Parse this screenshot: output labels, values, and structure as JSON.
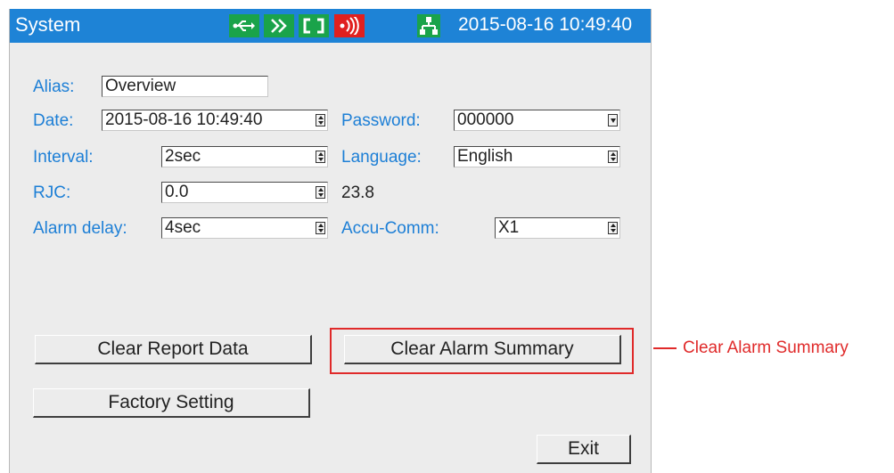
{
  "titlebar": {
    "title": "System",
    "datetime": "2015-08-16 10:49:40",
    "status_icons": [
      "usb-icon",
      "forward-arrows-icon",
      "bracket-icon",
      "wireless-signal-icon",
      "network-icon"
    ]
  },
  "form": {
    "alias": {
      "label": "Alias:",
      "value": "Overview"
    },
    "date": {
      "label": "Date:",
      "value": "2015-08-16 10:49:40"
    },
    "password": {
      "label": "Password:",
      "value": "000000"
    },
    "interval": {
      "label": "Interval:",
      "value": "2sec"
    },
    "language": {
      "label": "Language:",
      "value": "English"
    },
    "rjc": {
      "label": "RJC:",
      "value": "0.0",
      "reading": "23.8"
    },
    "alarm_delay": {
      "label": "Alarm delay:",
      "value": "4sec"
    },
    "accu_comm": {
      "label": "Accu-Comm:",
      "value": "X1"
    }
  },
  "buttons": {
    "clear_report": "Clear Report Data",
    "clear_alarm": "Clear Alarm Summary",
    "factory": "Factory Setting",
    "exit": "Exit"
  },
  "annotation": {
    "callout": "Clear Alarm Summary"
  },
  "colors": {
    "titlebar": "#1e83d6",
    "label": "#1d7fd6",
    "icon_green": "#1aa34a",
    "icon_red": "#e0201f",
    "highlight": "#e02a2a"
  }
}
